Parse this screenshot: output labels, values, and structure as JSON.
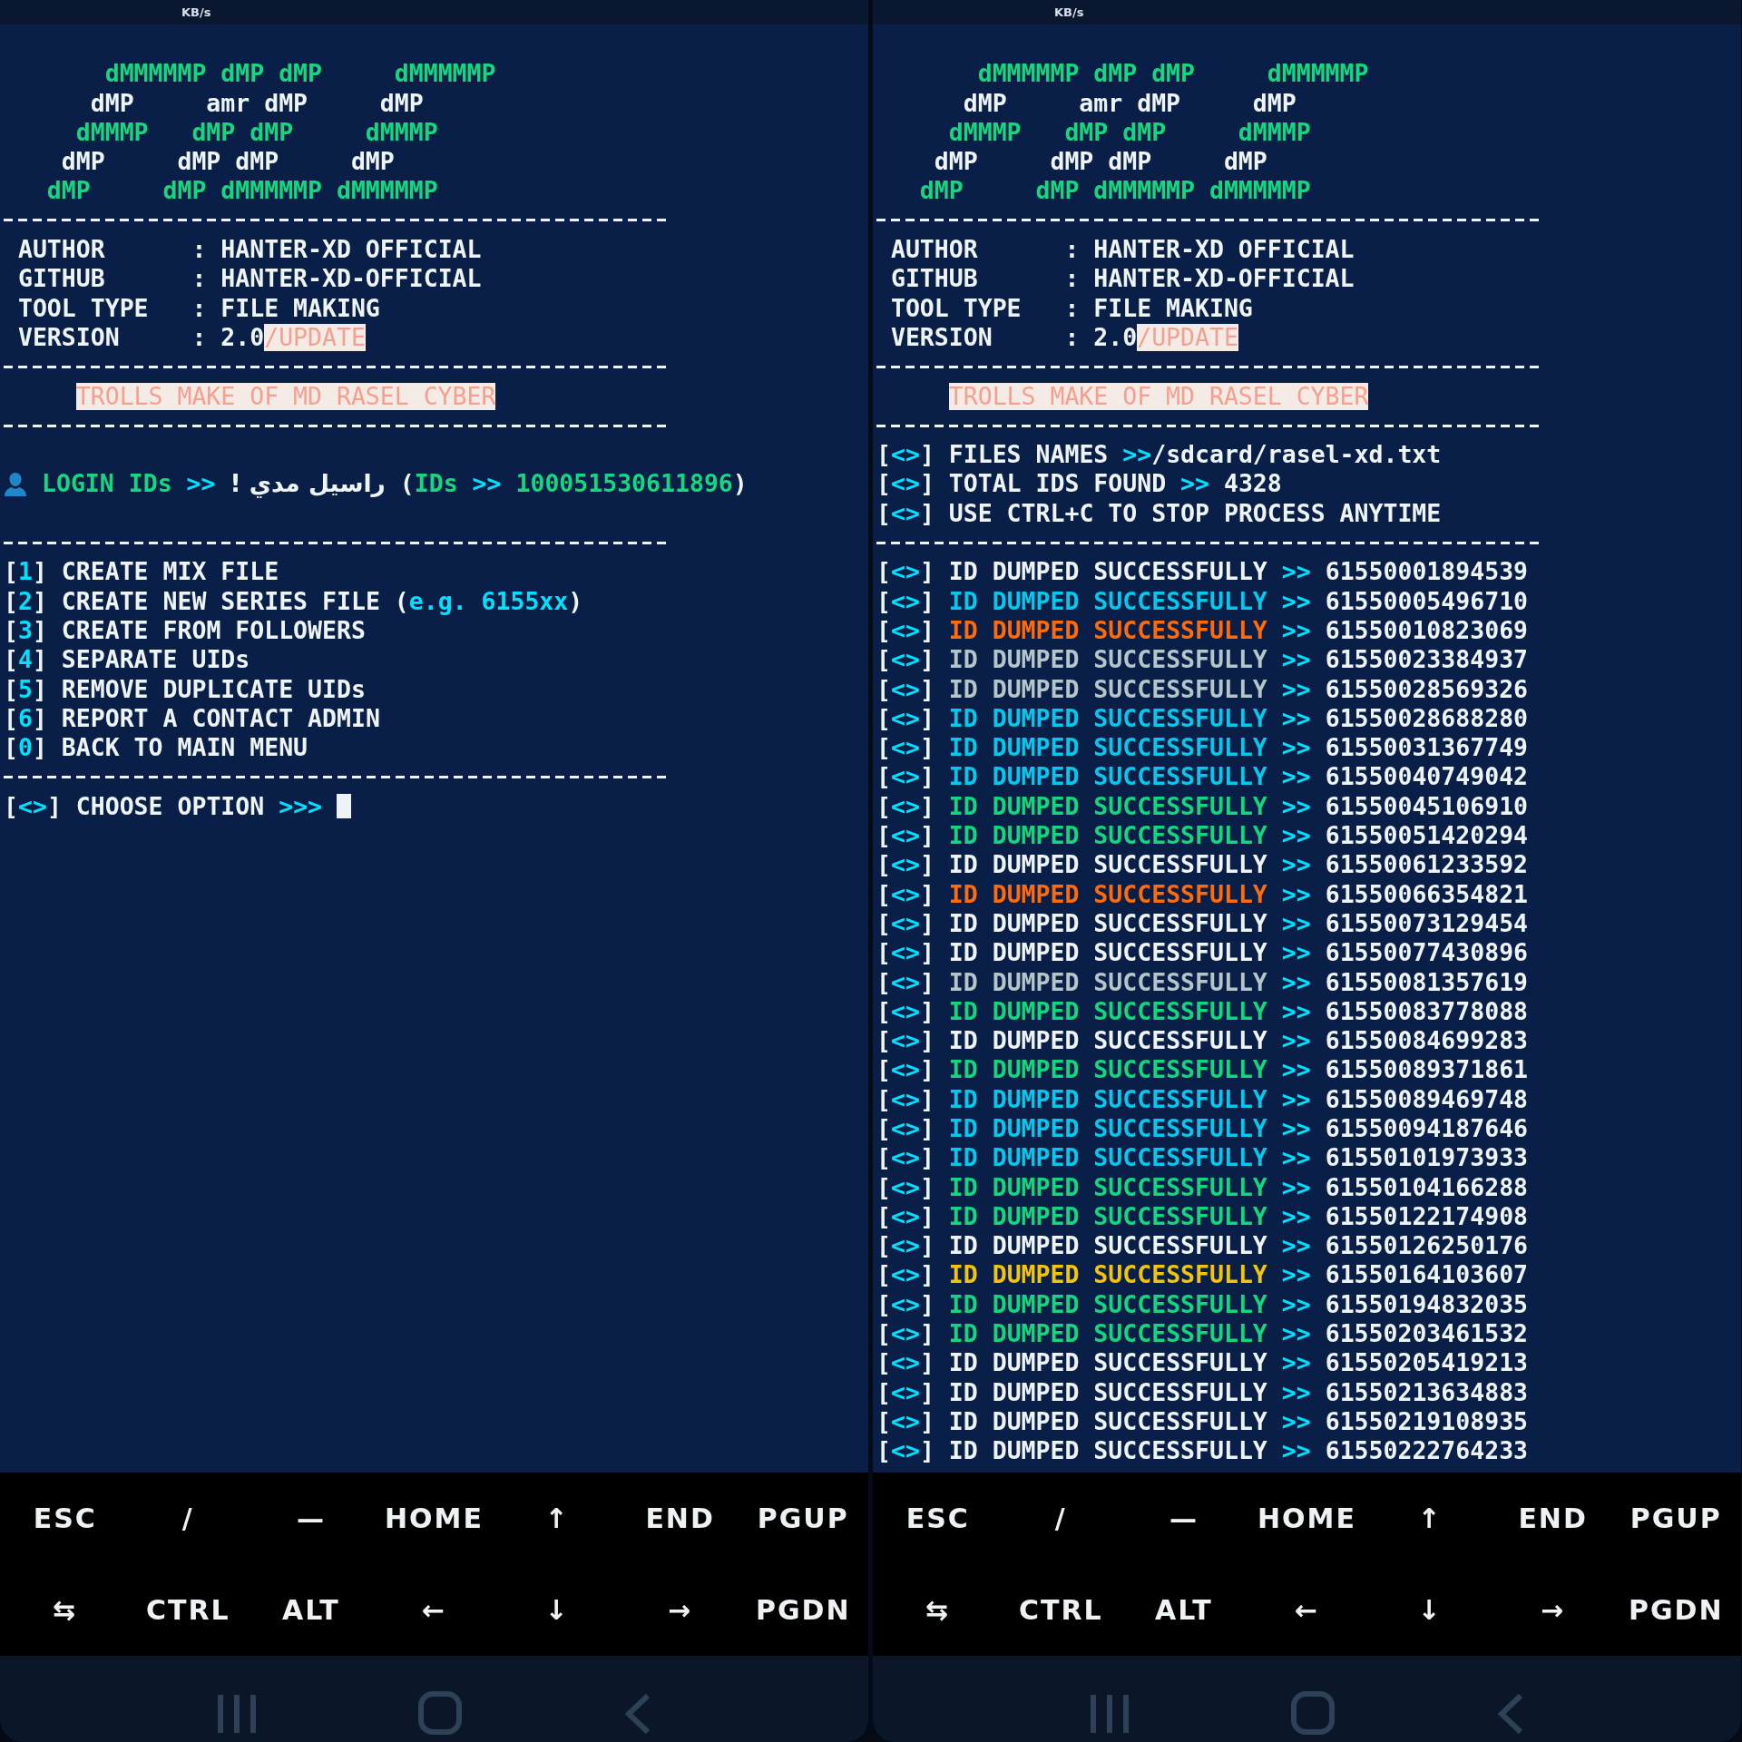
{
  "panels": [
    {
      "status_bar": {
        "speed_unit": "KB/s"
      },
      "lines": [
        {
          "kind": "blank"
        },
        {
          "kind": "art",
          "segments": [
            {
              "text": "       dMMMMMP dMP dMP     dMMMMMP",
              "kind": "green"
            }
          ]
        },
        {
          "kind": "art",
          "segments": [
            {
              "text": "      dMP     amr dMP     dMP",
              "kind": "plain"
            }
          ]
        },
        {
          "kind": "art",
          "segments": [
            {
              "text": "     dMMMP   dMP dMP     dMMMP",
              "kind": "green"
            }
          ]
        },
        {
          "kind": "art",
          "segments": [
            {
              "text": "    dMP     dMP dMP     dMP",
              "kind": "plain"
            }
          ]
        },
        {
          "kind": "art",
          "segments": [
            {
              "text": "   dMP     dMP dMMMMMP dMMMMMP",
              "kind": "green"
            }
          ]
        },
        {
          "kind": "rule"
        },
        {
          "kind": "text",
          "segments": [
            {
              "text": " AUTHOR      : HANTER-XD OFFICIAL",
              "kind": "plain"
            }
          ]
        },
        {
          "kind": "text",
          "segments": [
            {
              "text": " GITHUB      : HANTER-XD-OFFICIAL",
              "kind": "plain"
            }
          ]
        },
        {
          "kind": "text",
          "segments": [
            {
              "text": " TOOL TYPE   : FILE MAKING",
              "kind": "plain"
            }
          ]
        },
        {
          "kind": "text",
          "segments": [
            {
              "text": " VERSION     : 2.0",
              "kind": "plain"
            },
            {
              "text": "/UPDATE",
              "kind": "tag"
            }
          ]
        },
        {
          "kind": "rule"
        },
        {
          "kind": "banner",
          "segments": [
            {
              "text": "TROLLS MAKE OF MD RASEL CYBER",
              "kind": "tag"
            }
          ]
        },
        {
          "kind": "rule"
        },
        {
          "kind": "blank"
        },
        {
          "kind": "login",
          "segments": [
            {
              "text": "LOGIN IDs",
              "kind": "green"
            },
            {
              "text": " >> ",
              "kind": "accent"
            },
            {
              "text": "! راسيل مدي",
              "kind": "rtl"
            },
            {
              "text": " (",
              "kind": "plain"
            },
            {
              "text": "IDs",
              "kind": "green"
            },
            {
              "text": " >> ",
              "kind": "accent"
            },
            {
              "text": "100051530611896",
              "kind": "green"
            },
            {
              "text": ")",
              "kind": "plain"
            }
          ]
        },
        {
          "kind": "blank"
        },
        {
          "kind": "rule"
        },
        {
          "kind": "text",
          "segments": [
            {
              "text": "[",
              "kind": "plain"
            },
            {
              "text": "1",
              "kind": "accent"
            },
            {
              "text": "] CREATE MIX FILE",
              "kind": "plain"
            }
          ]
        },
        {
          "kind": "text",
          "segments": [
            {
              "text": "[",
              "kind": "plain"
            },
            {
              "text": "2",
              "kind": "accent"
            },
            {
              "text": "] CREATE NEW SERIES FILE (",
              "kind": "plain"
            },
            {
              "text": "e.g. 6155xx",
              "kind": "accent"
            },
            {
              "text": ")",
              "kind": "plain"
            }
          ]
        },
        {
          "kind": "text",
          "segments": [
            {
              "text": "[",
              "kind": "plain"
            },
            {
              "text": "3",
              "kind": "accent"
            },
            {
              "text": "] CREATE FROM FOLLOWERS",
              "kind": "plain"
            }
          ]
        },
        {
          "kind": "text",
          "segments": [
            {
              "text": "[",
              "kind": "plain"
            },
            {
              "text": "4",
              "kind": "accent"
            },
            {
              "text": "] SEPARATE UIDs",
              "kind": "plain"
            }
          ]
        },
        {
          "kind": "text",
          "segments": [
            {
              "text": "[",
              "kind": "plain"
            },
            {
              "text": "5",
              "kind": "accent"
            },
            {
              "text": "] REMOVE DUPLICATE UIDs",
              "kind": "plain"
            }
          ]
        },
        {
          "kind": "text",
          "segments": [
            {
              "text": "[",
              "kind": "plain"
            },
            {
              "text": "6",
              "kind": "accent"
            },
            {
              "text": "] REPORT A CONTACT ADMIN",
              "kind": "plain"
            }
          ]
        },
        {
          "kind": "text",
          "segments": [
            {
              "text": "[",
              "kind": "plain"
            },
            {
              "text": "0",
              "kind": "accent"
            },
            {
              "text": "] BACK TO MAIN MENU",
              "kind": "plain"
            }
          ]
        },
        {
          "kind": "rule"
        },
        {
          "kind": "text",
          "segments": [
            {
              "text": "[",
              "kind": "plain"
            },
            {
              "text": "<>",
              "kind": "accent"
            },
            {
              "text": "] CHOOSE OPTION ",
              "kind": "plain"
            },
            {
              "text": ">>>",
              "kind": "accent"
            },
            {
              "kind": "cursor"
            }
          ]
        }
      ],
      "extra_keys": [
        [
          "ESC",
          "/",
          "—",
          "HOME",
          "↑",
          "END",
          "PGUP"
        ],
        [
          "⇆",
          "CTRL",
          "ALT",
          "←",
          "↓",
          "→",
          "PGDN"
        ]
      ]
    },
    {
      "status_bar": {
        "speed_unit": "KB/s"
      },
      "lines": [
        {
          "kind": "blank"
        },
        {
          "kind": "art",
          "segments": [
            {
              "text": "       dMMMMMP dMP dMP     dMMMMMP",
              "kind": "green"
            }
          ]
        },
        {
          "kind": "art",
          "segments": [
            {
              "text": "      dMP     amr dMP     dMP",
              "kind": "plain"
            }
          ]
        },
        {
          "kind": "art",
          "segments": [
            {
              "text": "     dMMMP   dMP dMP     dMMMP",
              "kind": "green"
            }
          ]
        },
        {
          "kind": "art",
          "segments": [
            {
              "text": "    dMP     dMP dMP     dMP",
              "kind": "plain"
            }
          ]
        },
        {
          "kind": "art",
          "segments": [
            {
              "text": "   dMP     dMP dMMMMMP dMMMMMP",
              "kind": "green"
            }
          ]
        },
        {
          "kind": "rule"
        },
        {
          "kind": "text",
          "segments": [
            {
              "text": " AUTHOR      : HANTER-XD OFFICIAL",
              "kind": "plain"
            }
          ]
        },
        {
          "kind": "text",
          "segments": [
            {
              "text": " GITHUB      : HANTER-XD-OFFICIAL",
              "kind": "plain"
            }
          ]
        },
        {
          "kind": "text",
          "segments": [
            {
              "text": " TOOL TYPE   : FILE MAKING",
              "kind": "plain"
            }
          ]
        },
        {
          "kind": "text",
          "segments": [
            {
              "text": " VERSION     : 2.0",
              "kind": "plain"
            },
            {
              "text": "/UPDATE",
              "kind": "tag"
            }
          ]
        },
        {
          "kind": "rule"
        },
        {
          "kind": "banner",
          "segments": [
            {
              "text": "TROLLS MAKE OF MD RASEL CYBER",
              "kind": "tag"
            }
          ]
        },
        {
          "kind": "rule"
        },
        {
          "kind": "text",
          "segments": [
            {
              "text": "[",
              "kind": "plain"
            },
            {
              "text": "<>",
              "kind": "accent"
            },
            {
              "text": "] FILES NAMES ",
              "kind": "plain"
            },
            {
              "text": ">>",
              "kind": "accent"
            },
            {
              "text": "/sdcard/rasel-xd.txt",
              "kind": "plain"
            }
          ]
        },
        {
          "kind": "text",
          "segments": [
            {
              "text": "[",
              "kind": "plain"
            },
            {
              "text": "<>",
              "kind": "accent"
            },
            {
              "text": "] TOTAL IDS FOUND ",
              "kind": "plain"
            },
            {
              "text": ">>",
              "kind": "accent"
            },
            {
              "text": " 4328",
              "kind": "plain"
            }
          ]
        },
        {
          "kind": "text",
          "segments": [
            {
              "text": "[",
              "kind": "plain"
            },
            {
              "text": "<>",
              "kind": "accent"
            },
            {
              "text": "] USE CTRL+C TO STOP PROCESS ANYTIME",
              "kind": "plain"
            }
          ]
        },
        {
          "kind": "rule"
        }
      ],
      "dump_rows": [
        {
          "open": "[",
          "mark": "<>",
          "close": "]",
          "message": "ID DUMPED SUCCESSFULLY",
          "arrow": ">>",
          "id": "61550001894539",
          "color": "#eef4f4"
        },
        {
          "open": "[",
          "mark": "<>",
          "close": "]",
          "message": "ID DUMPED SUCCESSFULLY",
          "arrow": ">>",
          "id": "61550005496710",
          "color": "#06c8ec"
        },
        {
          "open": "[",
          "mark": "<>",
          "close": "]",
          "message": "ID DUMPED SUCCESSFULLY",
          "arrow": ">>",
          "id": "61550010823069",
          "color": "#ff6a0a"
        },
        {
          "open": "[",
          "mark": "<>",
          "close": "]",
          "message": "ID DUMPED SUCCESSFULLY",
          "arrow": ">>",
          "id": "61550023384937",
          "color": "#b4c6ca"
        },
        {
          "open": "[",
          "mark": "<>",
          "close": "]",
          "message": "ID DUMPED SUCCESSFULLY",
          "arrow": ">>",
          "id": "61550028569326",
          "color": "#b4c6ca"
        },
        {
          "open": "[",
          "mark": "<>",
          "close": "]",
          "message": "ID DUMPED SUCCESSFULLY",
          "arrow": ">>",
          "id": "61550028688280",
          "color": "#06c8ec"
        },
        {
          "open": "[",
          "mark": "<>",
          "close": "]",
          "message": "ID DUMPED SUCCESSFULLY",
          "arrow": ">>",
          "id": "61550031367749",
          "color": "#06c8ec"
        },
        {
          "open": "[",
          "mark": "<>",
          "close": "]",
          "message": "ID DUMPED SUCCESSFULLY",
          "arrow": ">>",
          "id": "61550040749042",
          "color": "#06c8ec"
        },
        {
          "open": "[",
          "mark": "<>",
          "close": "]",
          "message": "ID DUMPED SUCCESSFULLY",
          "arrow": ">>",
          "id": "61550045106910",
          "color": "#14d67e"
        },
        {
          "open": "[",
          "mark": "<>",
          "close": "]",
          "message": "ID DUMPED SUCCESSFULLY",
          "arrow": ">>",
          "id": "61550051420294",
          "color": "#14d67e"
        },
        {
          "open": "[",
          "mark": "<>",
          "close": "]",
          "message": "ID DUMPED SUCCESSFULLY",
          "arrow": ">>",
          "id": "61550061233592",
          "color": "#eef4f4"
        },
        {
          "open": "[",
          "mark": "<>",
          "close": "]",
          "message": "ID DUMPED SUCCESSFULLY",
          "arrow": ">>",
          "id": "61550066354821",
          "color": "#ff6a0a"
        },
        {
          "open": "[",
          "mark": "<>",
          "close": "]",
          "message": "ID DUMPED SUCCESSFULLY",
          "arrow": ">>",
          "id": "61550073129454",
          "color": "#eef4f4"
        },
        {
          "open": "[",
          "mark": "<>",
          "close": "]",
          "message": "ID DUMPED SUCCESSFULLY",
          "arrow": ">>",
          "id": "61550077430896",
          "color": "#eef4f4"
        },
        {
          "open": "[",
          "mark": "<>",
          "close": "]",
          "message": "ID DUMPED SUCCESSFULLY",
          "arrow": ">>",
          "id": "61550081357619",
          "color": "#b4c6ca"
        },
        {
          "open": "[",
          "mark": "<>",
          "close": "]",
          "message": "ID DUMPED SUCCESSFULLY",
          "arrow": ">>",
          "id": "61550083778088",
          "color": "#14d67e"
        },
        {
          "open": "[",
          "mark": "<>",
          "close": "]",
          "message": "ID DUMPED SUCCESSFULLY",
          "arrow": ">>",
          "id": "61550084699283",
          "color": "#eef4f4"
        },
        {
          "open": "[",
          "mark": "<>",
          "close": "]",
          "message": "ID DUMPED SUCCESSFULLY",
          "arrow": ">>",
          "id": "61550089371861",
          "color": "#14d67e"
        },
        {
          "open": "[",
          "mark": "<>",
          "close": "]",
          "message": "ID DUMPED SUCCESSFULLY",
          "arrow": ">>",
          "id": "61550089469748",
          "color": "#06c8ec"
        },
        {
          "open": "[",
          "mark": "<>",
          "close": "]",
          "message": "ID DUMPED SUCCESSFULLY",
          "arrow": ">>",
          "id": "61550094187646",
          "color": "#06c8ec"
        },
        {
          "open": "[",
          "mark": "<>",
          "close": "]",
          "message": "ID DUMPED SUCCESSFULLY",
          "arrow": ">>",
          "id": "61550101973933",
          "color": "#06c8ec"
        },
        {
          "open": "[",
          "mark": "<>",
          "close": "]",
          "message": "ID DUMPED SUCCESSFULLY",
          "arrow": ">>",
          "id": "61550104166288",
          "color": "#14d67e"
        },
        {
          "open": "[",
          "mark": "<>",
          "close": "]",
          "message": "ID DUMPED SUCCESSFULLY",
          "arrow": ">>",
          "id": "61550122174908",
          "color": "#14d67e"
        },
        {
          "open": "[",
          "mark": "<>",
          "close": "]",
          "message": "ID DUMPED SUCCESSFULLY",
          "arrow": ">>",
          "id": "61550126250176",
          "color": "#eef4f4"
        },
        {
          "open": "[",
          "mark": "<>",
          "close": "]",
          "message": "ID DUMPED SUCCESSFULLY",
          "arrow": ">>",
          "id": "61550164103607",
          "color": "#f2c40c"
        },
        {
          "open": "[",
          "mark": "<>",
          "close": "]",
          "message": "ID DUMPED SUCCESSFULLY",
          "arrow": ">>",
          "id": "61550194832035",
          "color": "#14d67e"
        },
        {
          "open": "[",
          "mark": "<>",
          "close": "]",
          "message": "ID DUMPED SUCCESSFULLY",
          "arrow": ">>",
          "id": "61550203461532",
          "color": "#14d67e"
        },
        {
          "open": "[",
          "mark": "<>",
          "close": "]",
          "message": "ID DUMPED SUCCESSFULLY",
          "arrow": ">>",
          "id": "61550205419213",
          "color": "#eef4f4"
        },
        {
          "open": "[",
          "mark": "<>",
          "close": "]",
          "message": "ID DUMPED SUCCESSFULLY",
          "arrow": ">>",
          "id": "61550213634883",
          "color": "#eef4f4"
        },
        {
          "open": "[",
          "mark": "<>",
          "close": "]",
          "message": "ID DUMPED SUCCESSFULLY",
          "arrow": ">>",
          "id": "61550219108935",
          "color": "#eef4f4"
        },
        {
          "open": "[",
          "mark": "<>",
          "close": "]",
          "message": "ID DUMPED SUCCESSFULLY",
          "arrow": ">>",
          "id": "61550222764233",
          "color": "#eef4f4"
        }
      ],
      "extra_keys": [
        [
          "ESC",
          "/",
          "—",
          "HOME",
          "↑",
          "END",
          "PGUP"
        ],
        [
          "⇆",
          "CTRL",
          "ALT",
          "←",
          "↓",
          "→",
          "PGDN"
        ]
      ]
    }
  ]
}
